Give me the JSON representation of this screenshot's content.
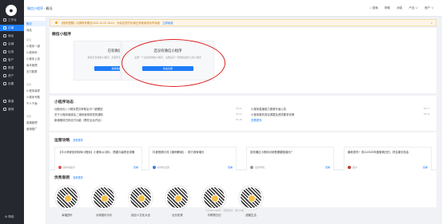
{
  "nav": {
    "logo": "●",
    "items": [
      "工作台",
      "订单",
      "商品",
      "店铺",
      "应用",
      "客户",
      "数据",
      "资产",
      "设置",
      "渠道",
      "营销"
    ],
    "bottom": "⚙ 帮助"
  },
  "topbar": {
    "crumbs": [
      "微信小程序",
      "概况"
    ],
    "right": [
      "⌕ 搜索",
      "帮助",
      "消息",
      "产品 ∨",
      "账户 ∨"
    ]
  },
  "sub": {
    "items": [
      "概况",
      "商品",
      "小程序一键",
      "小程序码",
      "小程序上线",
      "版本管理",
      "支付配置"
    ],
    "groups": [
      "配置",
      "运营",
      "流量"
    ],
    "items2": [
      "小程序装修",
      "小程序专题",
      "千人千面"
    ],
    "items3": [
      "直播管理",
      "营销推广"
    ]
  },
  "notice": {
    "text": "【服务提醒】店铺有效期至2022-12-20 18:15，为保证您的店铺正常使用请及时续费",
    "link": "立即续费"
  },
  "bind": {
    "title": "微信小程序",
    "card1_title": "已有微信小程序",
    "card1_desc": "授权已有微信小程序，无需开发，快速完成授权并发布小程序",
    "card1_btn": "授权微信小程序",
    "card2_title": "还没有微信小程序",
    "card2_desc": "注册一个全新的微信小程序，注册后可一键授权发布上线小程序",
    "card2_btn": "快速注册"
  },
  "dynamics": {
    "title": "小程序动态",
    "left": [
      {
        "text": "功能优化 | 小程序提交审核后可一键撤回",
        "time": "06-01"
      },
      {
        "text": "关于小程序链接及二维码使用规范的通知",
        "time": "05-24"
      },
      {
        "text": "新增微信扫码支付功能（需在后台开启）",
        "time": "05-18"
      }
    ],
    "right": [
      {
        "text": "小程序直播能力更新升级公告",
        "time": "05-17"
      },
      {
        "text": "小程序服务类目调整及资质要求说明",
        "time": "05-12"
      },
      {
        "text": "查看更多",
        "time": ""
      }
    ]
  },
  "strategy": {
    "title": "运营攻略",
    "more": "查看更多",
    "items": [
      {
        "title": "【中小商家如何玩转小程序】小程序从0到1，搭建与装修全攻略",
        "author": "微商城官方",
        "view": "查看"
      },
      {
        "title": "抖音视频引流【案例解读】：助力商家增长",
        "author": "新零售运营",
        "view": "查看"
      },
      {
        "title": "如何通过小程序月销售额翻倍增长？",
        "author": "运营学院",
        "view": "查看"
      },
      {
        "title": "最新发布！双11/2022年度营销日历，抓住增长机会",
        "author": "官方",
        "view": "查看"
      }
    ]
  },
  "cases": {
    "title": "优秀案例",
    "more": "查看更多",
    "names": [
      "幸福四叶",
      "大熊猫乐乐乐",
      "经纪人文化大全",
      "巨长奶茶",
      "乐购物日记",
      "甜蜜生活"
    ]
  },
  "footer": "Youzan ©2022 · 有赞科技 · 浙ICP备"
}
